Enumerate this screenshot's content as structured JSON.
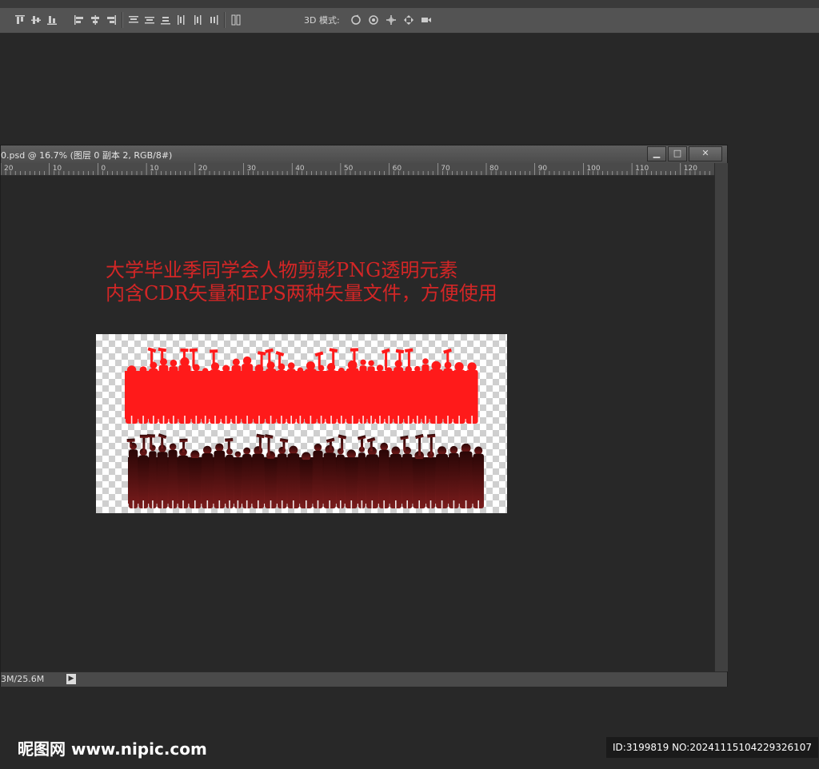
{
  "options_bar": {
    "mode_3d_label": "3D 模式:",
    "icons": [
      "align-top-icon",
      "align-vcenter-icon",
      "align-bottom-icon",
      "align-left-icon",
      "align-hcenter-icon",
      "align-right-icon",
      "distribute-top-icon",
      "distribute-vcenter-icon",
      "distribute-bottom-icon",
      "distribute-left-icon",
      "distribute-hcenter-icon",
      "distribute-right-icon",
      "auto-align-icon",
      "rotate-3d-icon",
      "roll-3d-icon",
      "drag-3d-icon",
      "slide-3d-icon",
      "scale-3d-icon"
    ]
  },
  "document": {
    "title": "0.psd @ 16.7% (图层 0 副本 2, RGB/8#)",
    "window_buttons": {
      "minimize": "▁",
      "maximize": "□",
      "close": "✕"
    },
    "ruler_labels": [
      "20",
      "10",
      "0",
      "10",
      "20",
      "30",
      "40",
      "50",
      "60",
      "70",
      "80",
      "90",
      "100",
      "110",
      "120"
    ],
    "status_text": "3M/25.6M",
    "status_arrow": "▶"
  },
  "canvas_text": {
    "line1": "大学毕业季同学会人物剪影PNG透明元素",
    "line2": "内含CDR矢量和EPS两种矢量文件，方便使用"
  },
  "artwork": {
    "top_row_color": "#ff1a1a",
    "bottom_row_color_top": "#2a0606",
    "bottom_row_color_bottom": "#7a1c1c"
  },
  "footer": {
    "logo": "昵图网 www.nipic.com",
    "id_text": "ID:3199819 NO:20241115104229326107"
  }
}
